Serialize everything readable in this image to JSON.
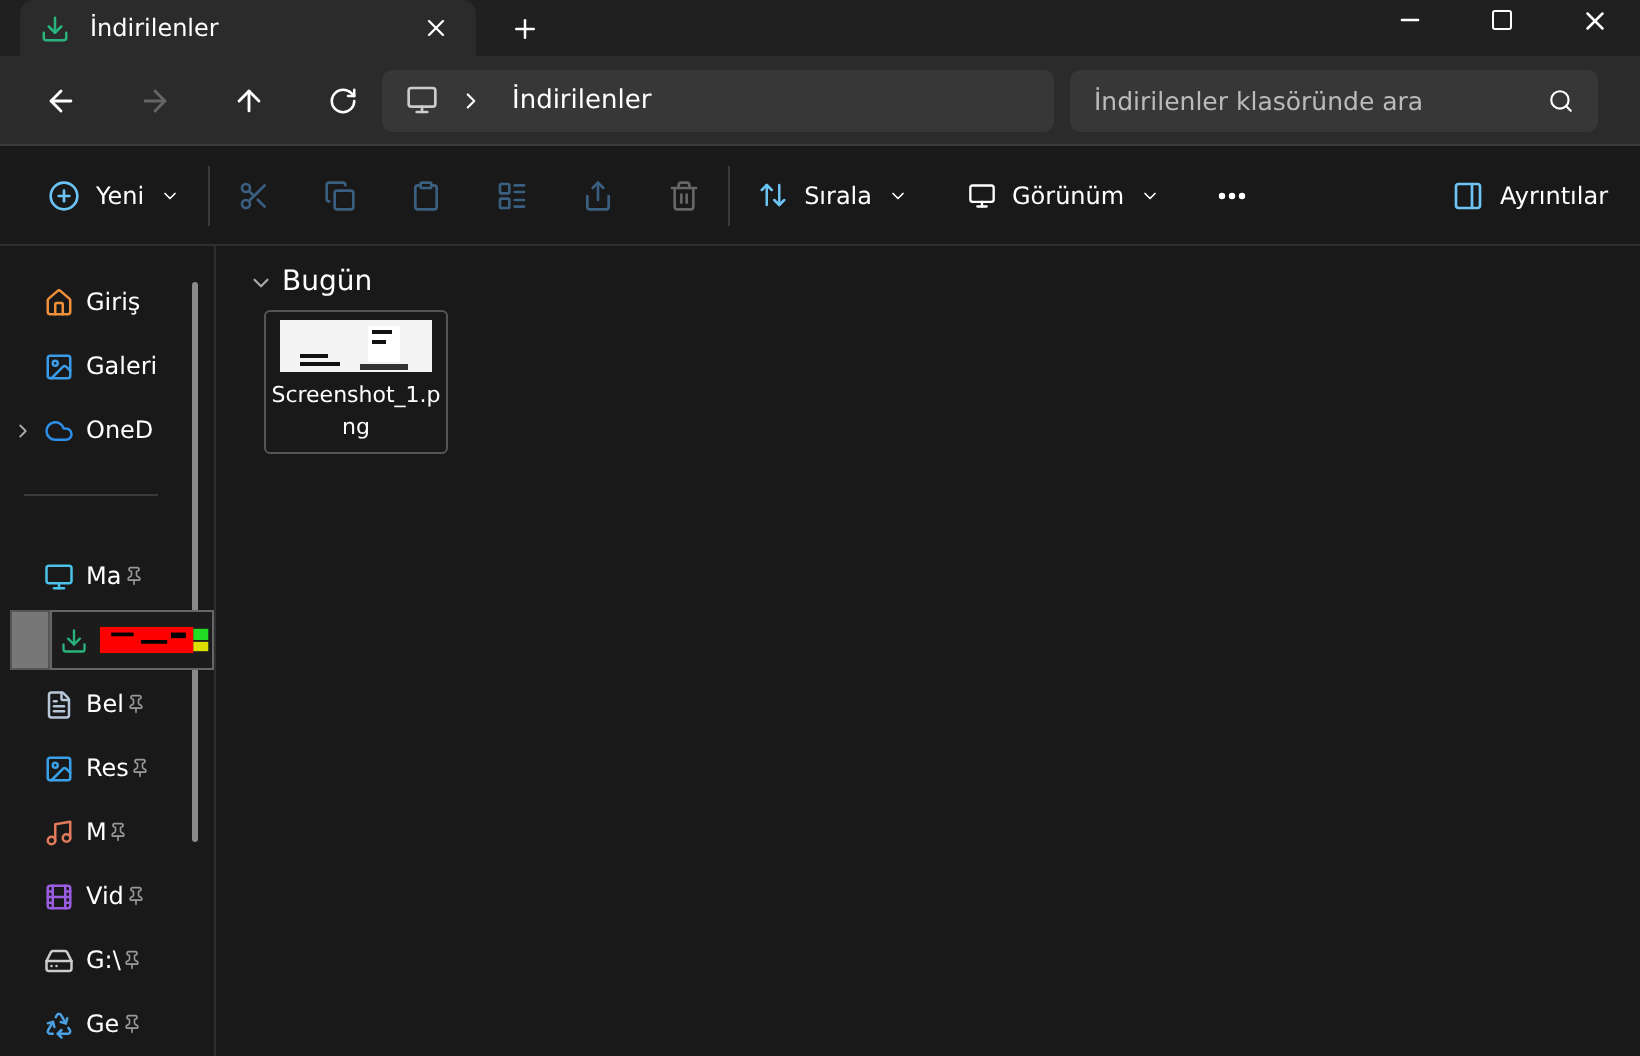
{
  "tab": {
    "title": "İndirilenler"
  },
  "address": {
    "path": "İndirilenler"
  },
  "search": {
    "placeholder": "İndirilenler klasöründe ara"
  },
  "toolbar": {
    "new": "Yeni",
    "sort": "Sırala",
    "view": "Görünüm",
    "details": "Ayrıntılar"
  },
  "sidebar": {
    "sections": [
      {
        "items": [
          {
            "kind": "home",
            "label": "Giriş",
            "pinned": false,
            "expandable": false,
            "selected": false
          },
          {
            "kind": "gallery",
            "label": "Galeri",
            "pinned": false,
            "expandable": false,
            "selected": false
          },
          {
            "kind": "cloud",
            "label": "OneD",
            "pinned": false,
            "expandable": true,
            "selected": false
          }
        ]
      },
      {
        "items": [
          {
            "kind": "desktop",
            "label": "Ma",
            "pinned": true,
            "expandable": false,
            "selected": false
          },
          {
            "kind": "download",
            "selected": true
          },
          {
            "kind": "document",
            "label": "Bel",
            "pinned": true,
            "expandable": false,
            "selected": false
          },
          {
            "kind": "pictures",
            "label": "Res",
            "pinned": true,
            "expandable": false,
            "selected": false
          },
          {
            "kind": "music",
            "label": "M",
            "pinned": true,
            "expandable": false,
            "selected": false
          },
          {
            "kind": "video",
            "label": "Vid",
            "pinned": true,
            "expandable": false,
            "selected": false
          },
          {
            "kind": "drive",
            "label": "G:\\",
            "pinned": true,
            "expandable": false,
            "selected": false
          },
          {
            "kind": "recycle",
            "label": "Ge",
            "pinned": true,
            "expandable": false,
            "selected": false
          }
        ]
      }
    ]
  },
  "groups": [
    {
      "title": "Bugün",
      "expanded": true,
      "files": [
        {
          "name": "Screenshot_1.png"
        }
      ]
    }
  ]
}
